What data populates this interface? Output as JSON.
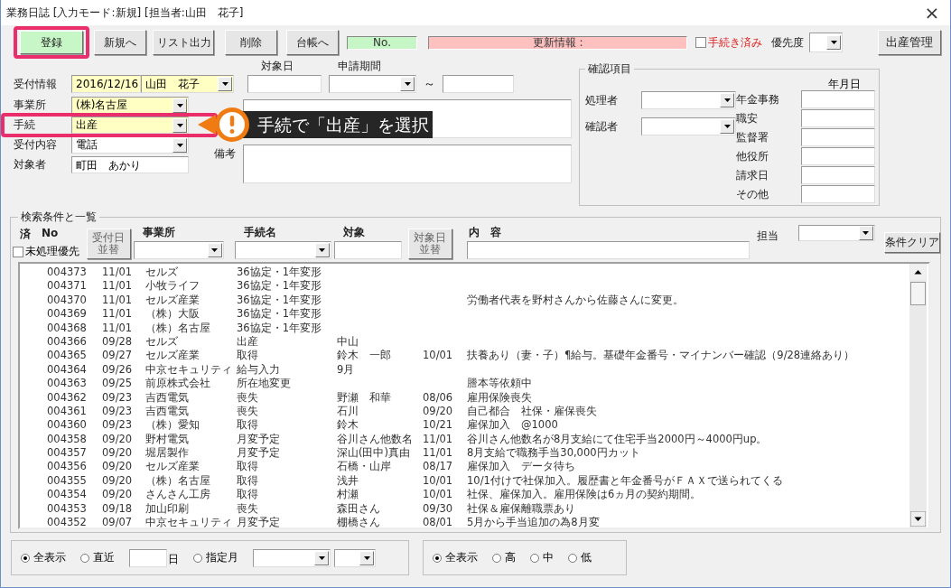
{
  "window": {
    "title": "業務日誌 [入力モード:新規] [担当者:山田　花子]",
    "close": "×"
  },
  "toolbar": {
    "buttons": [
      {
        "label": "登録",
        "kind": "primary",
        "highlighted": true
      },
      {
        "label": "新規へ",
        "kind": "plain",
        "highlighted": false
      },
      {
        "label": "リスト出力",
        "kind": "plain",
        "highlighted": false
      },
      {
        "label": "削除",
        "kind": "plain",
        "highlighted": false
      },
      {
        "label": "台帳へ",
        "kind": "plain",
        "highlighted": false
      }
    ],
    "number_field": "No.",
    "update_info": "更新情報 :",
    "done_checkbox": {
      "label": "手続き済み",
      "checked": false
    },
    "priority_label": "優先度",
    "right_button": "出産管理"
  },
  "form": {
    "target_date_label": "対象日",
    "period_label": "申請期間",
    "reception": {
      "label": "受付情報",
      "date": "2016/12/16",
      "staff": "山田　花子"
    },
    "period_separator": "～",
    "fields": [
      {
        "label": "事業所",
        "value": "(株)名古屋",
        "kind": "combo",
        "required": true,
        "highlighted": false
      },
      {
        "label": "手続",
        "value": "出産",
        "kind": "combo",
        "required": true,
        "highlighted": true
      },
      {
        "label": "受付内容",
        "value": "電話",
        "kind": "combo",
        "required": false,
        "highlighted": false
      },
      {
        "label": "対象者",
        "value": "町田　あかり",
        "kind": "text",
        "required": false,
        "highlighted": false
      }
    ],
    "remarks_label": "備考"
  },
  "callout": {
    "text": "手続で「出産」を選択"
  },
  "confirmation": {
    "title": "確認項目",
    "people": [
      {
        "label": "処理者"
      },
      {
        "label": "確認者"
      }
    ],
    "dates_header": "年月日",
    "dates": [
      {
        "label": "年金事務"
      },
      {
        "label": "職安"
      },
      {
        "label": "監督署"
      },
      {
        "label": "他役所"
      },
      {
        "label": "請求日"
      },
      {
        "label": "その他"
      }
    ]
  },
  "search": {
    "title": "検索条件と一覧",
    "done_label": "済",
    "no_label": "No",
    "unprocessed_first": {
      "label": "未処理優先",
      "checked": false
    },
    "sort_reception": "受付日並替",
    "company_label": "事業所",
    "procedure_label": "手続名",
    "target_label": "対象",
    "sort_target": "対象日並替",
    "content_label": "内　容",
    "staff_label": "担当",
    "clear_button": "条件クリア",
    "rows": [
      {
        "no": "004373",
        "date": "11/01",
        "company": "セルズ",
        "procedure": "36協定・1年変形"
      },
      {
        "no": "004371",
        "date": "11/01",
        "company": "小牧ライフ",
        "procedure": "36協定・1年変形"
      },
      {
        "no": "004370",
        "date": "11/01",
        "company": "セルズ産業",
        "procedure": "36協定・1年変形",
        "content": "労働者代表を野村さんから佐藤さんに変更。"
      },
      {
        "no": "004369",
        "date": "11/01",
        "company": "（株）大阪",
        "procedure": "36協定・1年変形"
      },
      {
        "no": "004368",
        "date": "11/01",
        "company": "（株）名古屋",
        "procedure": "36協定・1年変形"
      },
      {
        "no": "004366",
        "date": "09/28",
        "company": "セルズ",
        "procedure": "出産",
        "target": "中山"
      },
      {
        "no": "004365",
        "date": "09/27",
        "company": "セルズ産業",
        "procedure": "取得",
        "target": "鈴木　一郎",
        "target_date": "10/01",
        "content": "扶養あり（妻・子）¶給与。基礎年金番号・マイナンバー確認（9/28連絡あり）"
      },
      {
        "no": "004364",
        "date": "09/26",
        "company": "中京セキュリティ",
        "procedure": "給与入力",
        "target": "9月"
      },
      {
        "no": "004363",
        "date": "09/25",
        "company": "前原株式会社",
        "procedure": "所在地変更",
        "content": "謄本等依頼中"
      },
      {
        "no": "004362",
        "date": "09/23",
        "company": "吉西電気",
        "procedure": "喪失",
        "target": "野瀬　和華",
        "target_date": "08/06",
        "content": "雇用保険喪失"
      },
      {
        "no": "004361",
        "date": "09/23",
        "company": "吉西電気",
        "procedure": "喪失",
        "target": "石川",
        "target_date": "09/20",
        "content": "自己都合　社保・雇保喪失"
      },
      {
        "no": "004360",
        "date": "09/23",
        "company": "（株）愛知",
        "procedure": "取得",
        "target": "鈴木",
        "target_date": "10/21",
        "content": "雇保加入　@1000"
      },
      {
        "no": "004358",
        "date": "09/20",
        "company": "野村電気",
        "procedure": "月変予定",
        "target": "谷川さん他数名",
        "target_date": "11/01",
        "content": "谷川さん他数名が8月支給にて住宅手当2000円～4000円up。"
      },
      {
        "no": "004357",
        "date": "09/20",
        "company": "堀居製作",
        "procedure": "月変予定",
        "target": "深山(田中)真由",
        "target_date": "11/01",
        "content": "8月支給で職務手当30,000円カット"
      },
      {
        "no": "004356",
        "date": "09/20",
        "company": "セルズ産業",
        "procedure": "取得",
        "target": "石橋・山岸",
        "target_date": "08/17",
        "content": "雇保加入　データ待ち"
      },
      {
        "no": "004355",
        "date": "09/20",
        "company": "（株）名古屋",
        "procedure": "取得",
        "target": "浅井",
        "target_date": "10/01",
        "content": "10/1付けで社保加入。履歴書と年金番号がＦＡＸで送られてくる"
      },
      {
        "no": "004354",
        "date": "09/20",
        "company": "さんさん工房",
        "procedure": "取得",
        "target": "村瀬",
        "target_date": "10/01",
        "content": "社保、雇保加入。雇用保険は6ヵ月の契約期間。"
      },
      {
        "no": "004353",
        "date": "09/18",
        "company": "加山印刷",
        "procedure": "喪失",
        "target": "森田さん",
        "target_date": "09/30",
        "content": "社保＆雇保離職票あり"
      },
      {
        "no": "004352",
        "date": "09/07",
        "company": "中京セキュリティ",
        "procedure": "月変予定",
        "target": "棚橋さん",
        "target_date": "08/01",
        "content": "5月から手当追加の為8月変"
      }
    ]
  },
  "filters": [
    {
      "items": [
        {
          "kind": "radio",
          "label": "全表示",
          "selected": true
        },
        {
          "kind": "radio",
          "label": "直近",
          "selected": false
        },
        {
          "kind": "field"
        },
        {
          "kind": "unit",
          "label": "日"
        },
        {
          "kind": "radio",
          "label": "指定月",
          "selected": false
        },
        {
          "kind": "combo"
        },
        {
          "kind": "mini_combo"
        }
      ]
    },
    {
      "items": [
        {
          "kind": "radio",
          "label": "全表示",
          "selected": true
        },
        {
          "kind": "radio",
          "label": "高",
          "selected": false
        },
        {
          "kind": "radio",
          "label": "中",
          "selected": false
        },
        {
          "kind": "radio",
          "label": "低",
          "selected": false
        }
      ]
    }
  ]
}
